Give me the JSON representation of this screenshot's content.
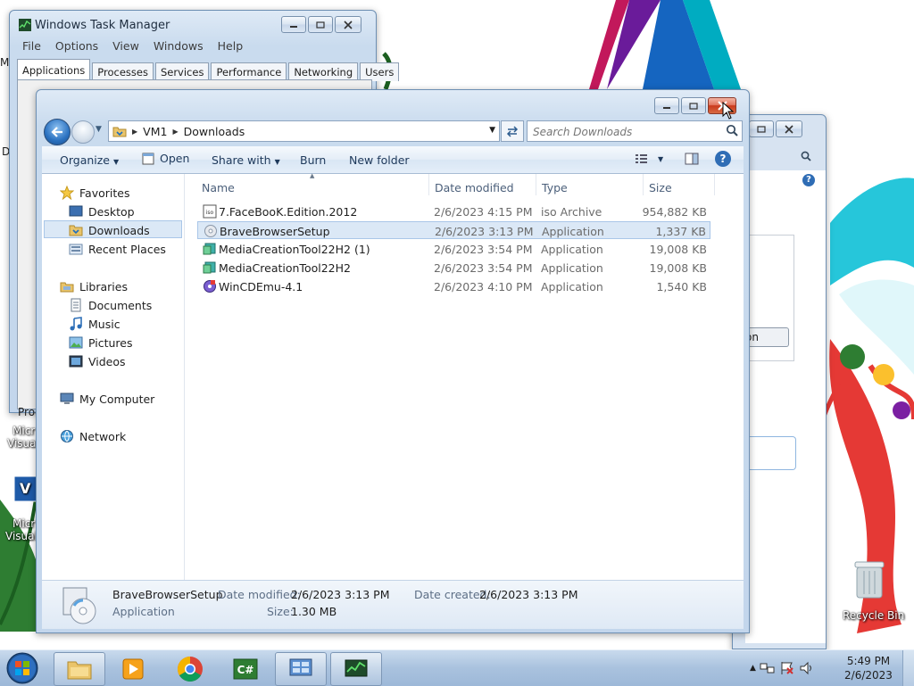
{
  "task_manager": {
    "title": "Windows Task Manager",
    "menu": [
      "File",
      "Options",
      "View",
      "Windows",
      "Help"
    ],
    "tabs": [
      "Applications",
      "Processes",
      "Services",
      "Performance",
      "Networking",
      "Users"
    ],
    "active_tab": "Applications",
    "footer_fragment": "Proc"
  },
  "explorer": {
    "breadcrumb": [
      "VM1",
      "Downloads"
    ],
    "search_placeholder": "Search Downloads",
    "toolbar": {
      "organize": "Organize",
      "open": "Open",
      "share_with": "Share with",
      "burn": "Burn",
      "new_folder": "New folder"
    },
    "nav": {
      "favorites_header": "Favorites",
      "favorites": [
        "Desktop",
        "Downloads",
        "Recent Places"
      ],
      "libraries_header": "Libraries",
      "libraries": [
        "Documents",
        "Music",
        "Pictures",
        "Videos"
      ],
      "computer": "My Computer",
      "network": "Network"
    },
    "selected_nav": "Downloads",
    "columns": [
      "Name",
      "Date modified",
      "Type",
      "Size"
    ],
    "files": [
      {
        "name": "7.FaceBooK.Edition.2012",
        "date": "2/6/2023 4:15 PM",
        "type": "iso Archive",
        "size": "954,882 KB",
        "icon": "iso-icon"
      },
      {
        "name": "BraveBrowserSetup",
        "date": "2/6/2023 3:13 PM",
        "type": "Application",
        "size": "1,337 KB",
        "icon": "setup-icon"
      },
      {
        "name": "MediaCreationTool22H2 (1)",
        "date": "2/6/2023 3:54 PM",
        "type": "Application",
        "size": "19,008 KB",
        "icon": "media-tool-icon"
      },
      {
        "name": "MediaCreationTool22H2",
        "date": "2/6/2023 3:54 PM",
        "type": "Application",
        "size": "19,008 KB",
        "icon": "media-tool-icon"
      },
      {
        "name": "WinCDEmu-4.1",
        "date": "2/6/2023 4:10 PM",
        "type": "Application",
        "size": "1,540 KB",
        "icon": "wincdemu-icon"
      }
    ],
    "selected_file": "BraveBrowserSetup",
    "details": {
      "name": "BraveBrowserSetup",
      "type": "Application",
      "date_modified_label": "Date modified:",
      "date_modified": "2/6/2023 3:13 PM",
      "date_created_label": "Date created:",
      "date_created": "2/6/2023 3:13 PM",
      "size_label": "Size:",
      "size": "1.30 MB"
    }
  },
  "background_fragments": {
    "button_fragment": "on",
    "desktop_icon_label_1a": "Micr",
    "desktop_icon_label_1b": "Visual",
    "desktop_icon_label_2a": "Micr",
    "desktop_icon_label_2b": "Visual",
    "desktop_icon_badge": "V",
    "recycle_bin": "Recycle Bin",
    "left_edge_1": "M",
    "left_edge_2": "D"
  },
  "taskbar": {
    "time": "5:49 PM",
    "date": "2/6/2023",
    "apps": [
      "windows-explorer-icon",
      "media-player-icon",
      "chrome-icon",
      "csharp-icon",
      "control-panel-icon",
      "task-manager-icon"
    ]
  },
  "colors": {
    "accent": "#2a71c0",
    "selection": "#dbe8f6",
    "close_red": "#c9391c"
  }
}
